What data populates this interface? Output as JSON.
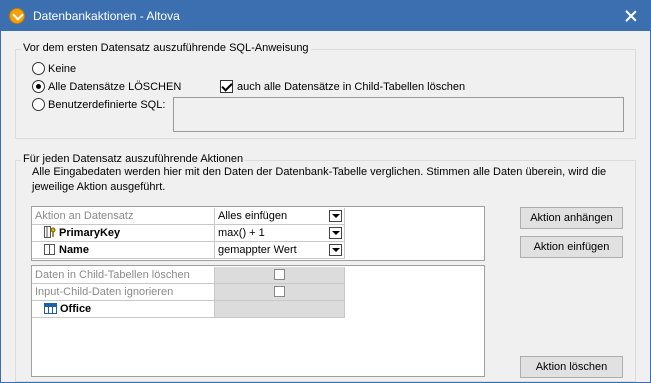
{
  "window": {
    "title": "Datenbankaktionen - Altova"
  },
  "sql_group": {
    "label": "Vor dem ersten Datensatz auszuführende SQL-Anweisung",
    "options": [
      {
        "label": "Keine",
        "checked": false
      },
      {
        "label": "Alle Datensätze LÖSCHEN",
        "checked": true
      },
      {
        "label": "Benutzerdefinierte SQL:",
        "checked": false
      }
    ],
    "child_delete_checkbox": {
      "label": "auch alle Datensätze in Child-Tabellen löschen",
      "checked": true
    },
    "custom_sql_value": ""
  },
  "actions_group": {
    "label": "Für jeden Datensatz auszuführende Aktionen",
    "description": "Alle Eingabedaten werden hier mit den Daten der Datenbank-Tabelle verglichen. Stimmen alle Daten überein, wird die jeweilige Aktion ausgeführt.",
    "action_grid": {
      "rows": [
        {
          "label": "Aktion an Datensatz",
          "value": "Alles einfügen"
        },
        {
          "label": "PrimaryKey",
          "value": "max() + 1"
        },
        {
          "label": "Name",
          "value": "gemappter Wert"
        }
      ]
    },
    "options_grid": {
      "rows": [
        {
          "label": "Daten in Child-Tabellen löschen",
          "checked": false
        },
        {
          "label": "Input-Child-Daten ignorieren",
          "checked": false
        },
        {
          "label": "Office"
        }
      ]
    },
    "buttons": {
      "append": "Aktion anhängen",
      "insert": "Aktion einfügen",
      "delete": "Aktion löschen"
    }
  }
}
